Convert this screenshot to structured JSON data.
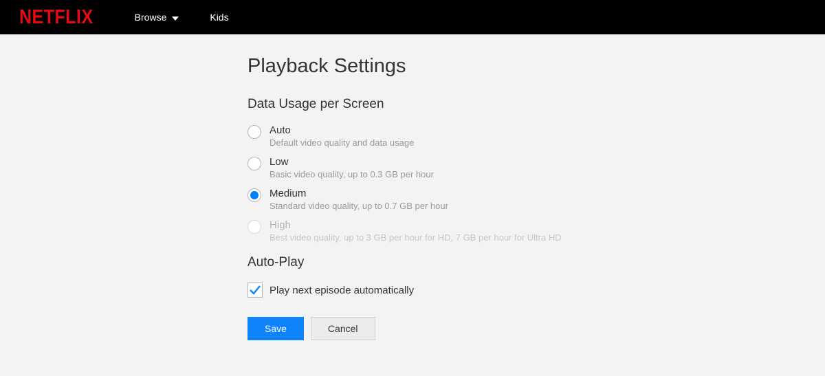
{
  "header": {
    "logo": "NETFLIX",
    "nav": {
      "browse": "Browse",
      "kids": "Kids"
    }
  },
  "page_title": "Playback Settings",
  "sections": {
    "data_usage": {
      "title": "Data Usage per Screen",
      "options": [
        {
          "label": "Auto",
          "desc": "Default video quality and data usage",
          "selected": false,
          "disabled": false
        },
        {
          "label": "Low",
          "desc": "Basic video quality, up to 0.3 GB per hour",
          "selected": false,
          "disabled": false
        },
        {
          "label": "Medium",
          "desc": "Standard video quality, up to 0.7 GB per hour",
          "selected": true,
          "disabled": false
        },
        {
          "label": "High",
          "desc": "Best video quality, up to 3 GB per hour for HD, 7 GB per hour for Ultra HD",
          "selected": false,
          "disabled": true
        }
      ]
    },
    "auto_play": {
      "title": "Auto-Play",
      "checkbox_label": "Play next episode automatically",
      "checked": true
    }
  },
  "buttons": {
    "save": "Save",
    "cancel": "Cancel"
  }
}
